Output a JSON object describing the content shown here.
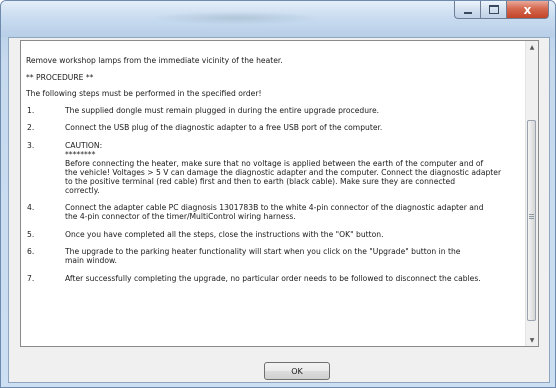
{
  "window": {
    "caption": {
      "minimize_icon": "minimize-icon",
      "maximize_icon": "maximize-icon",
      "close_icon": "close-icon",
      "close_glyph": "x"
    }
  },
  "instructions": {
    "intro": "Remove workshop lamps from the immediate vicinity of the heater.",
    "procedure_heading": "** PROCEDURE **",
    "order_note": "The following steps must be performed in the specified order!",
    "steps": [
      {
        "number": "1.",
        "lines": [
          "The supplied dongle must remain plugged in during the entire upgrade procedure."
        ]
      },
      {
        "number": "2.",
        "lines": [
          "Connect the USB plug of the diagnostic adapter to a free USB port of the computer."
        ]
      },
      {
        "number": "3.",
        "lines": [
          "CAUTION:",
          "********",
          "Before connecting the heater, make sure that no voltage is applied between the earth of the computer and of",
          "the vehicle! Voltages > 5 V can damage the diagnostic adapter and the computer. Connect the diagnostic adapter",
          "to the positive terminal (red cable) first and then to earth (black cable). Make sure they are connected",
          "correctly."
        ]
      },
      {
        "number": "4.",
        "lines": [
          "Connect the adapter cable PC diagnosis 1301783B to the white 4-pin connector of the diagnostic adapter and",
          "the 4-pin connector of the timer/MultiControl wiring harness."
        ]
      },
      {
        "number": "5.",
        "lines": [
          "Once you have completed all the steps, close the instructions with the \"OK\" button."
        ]
      },
      {
        "number": "6.",
        "lines": [
          "The upgrade to the parking heater functionality will start when you click on the \"Upgrade\" button in the",
          "main window."
        ]
      },
      {
        "number": "7.",
        "lines": [
          "After successfully completing the upgrade, no particular order needs to be followed to disconnect the cables."
        ]
      }
    ]
  },
  "scrollbar": {
    "up_arrow": "▲",
    "down_arrow": "▼"
  },
  "footer": {
    "ok_label": "OK"
  }
}
